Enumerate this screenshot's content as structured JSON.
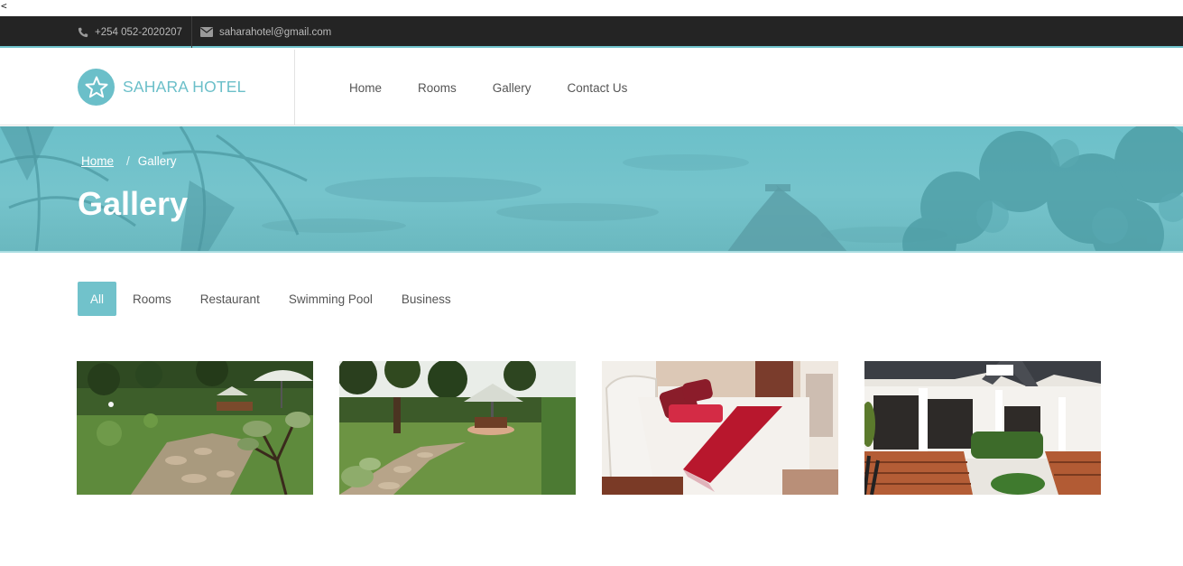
{
  "stray_char": "<",
  "topbar": {
    "phone": "+254 052-2020207",
    "email": "saharahotel@gmail.com",
    "phone_icon": "phone-icon",
    "email_icon": "envelope-icon"
  },
  "header": {
    "logo_icon": "star-icon",
    "logo_text": "SAHARA HOTEL",
    "nav": [
      "Home",
      "Rooms",
      "Gallery",
      "Contact Us"
    ]
  },
  "hero": {
    "breadcrumb_home": "Home",
    "breadcrumb_sep": "/",
    "breadcrumb_current": "Gallery",
    "title": "Gallery"
  },
  "filters": {
    "items": [
      "All",
      "Rooms",
      "Restaurant",
      "Swimming Pool",
      "Business"
    ],
    "active": "All"
  },
  "gallery": {
    "images": [
      "garden-lawn-photo",
      "garden-tables-photo",
      "hotel-bedroom-photo",
      "hotel-building-photo"
    ]
  },
  "colors": {
    "accent": "#6bbfc9",
    "topbar_bg": "#242424"
  }
}
